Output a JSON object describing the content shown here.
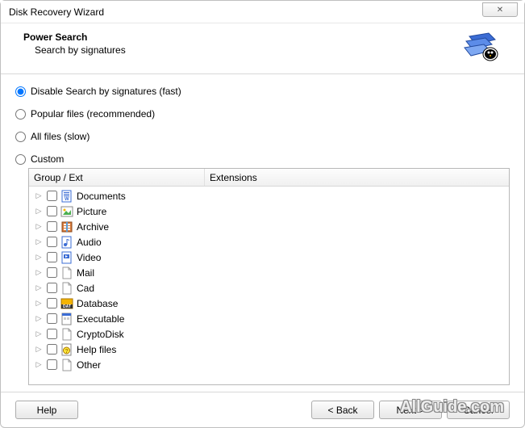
{
  "window": {
    "title": "Disk Recovery Wizard",
    "close_glyph": "✕"
  },
  "header": {
    "title": "Power Search",
    "subtitle": "Search by signatures"
  },
  "options": {
    "opt1": "Disable Search by signatures (fast)",
    "opt2": "Popular files (recommended)",
    "opt3": "All files (slow)",
    "opt4": "Custom",
    "selected": "opt1"
  },
  "tree": {
    "col1": "Group / Ext",
    "col2": "Extensions",
    "items": [
      {
        "label": "Documents",
        "icon": "doc"
      },
      {
        "label": "Picture",
        "icon": "pic"
      },
      {
        "label": "Archive",
        "icon": "arc"
      },
      {
        "label": "Audio",
        "icon": "aud"
      },
      {
        "label": "Video",
        "icon": "vid"
      },
      {
        "label": "Mail",
        "icon": "blank"
      },
      {
        "label": "Cad",
        "icon": "blank"
      },
      {
        "label": "Database",
        "icon": "db"
      },
      {
        "label": "Executable",
        "icon": "exe"
      },
      {
        "label": "CryptoDisk",
        "icon": "blank"
      },
      {
        "label": "Help files",
        "icon": "help"
      },
      {
        "label": "Other",
        "icon": "blank"
      }
    ]
  },
  "buttons": {
    "help": "Help",
    "back": "< Back",
    "next": "Next >",
    "cancel": "Cancel"
  },
  "watermark": "AllGuide.com"
}
